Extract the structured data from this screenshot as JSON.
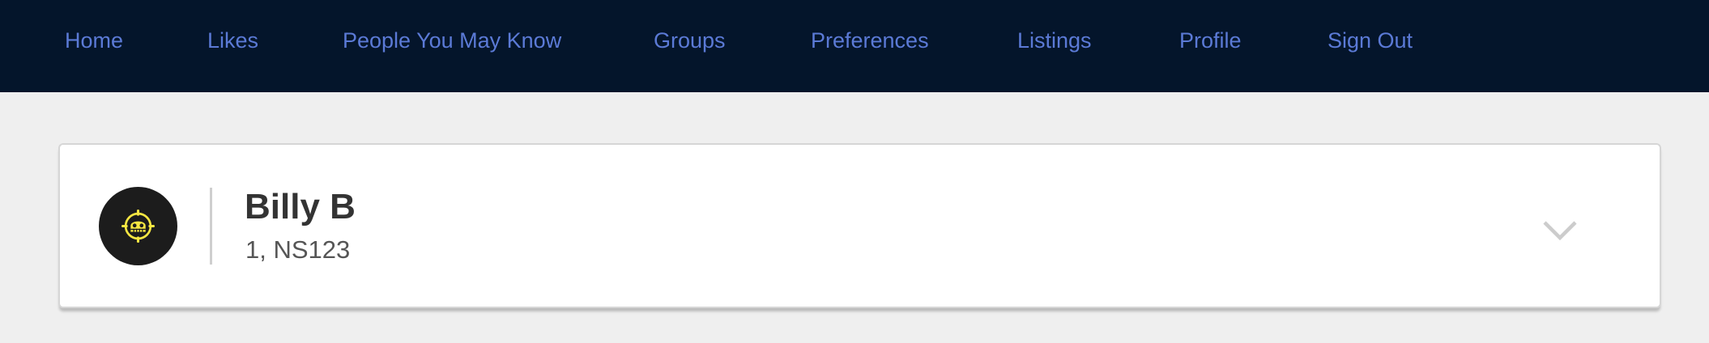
{
  "nav": {
    "items": [
      {
        "label": "Home"
      },
      {
        "label": "Likes"
      },
      {
        "label": "People You May Know"
      },
      {
        "label": "Groups"
      },
      {
        "label": "Preferences"
      },
      {
        "label": "Listings"
      },
      {
        "label": "Profile"
      },
      {
        "label": "Sign Out"
      }
    ]
  },
  "profile_card": {
    "name": "Billy B",
    "subtitle": "1, NS123",
    "avatar_icon": "skull-jolly-roger-icon",
    "expand_icon": "chevron-down-icon"
  },
  "colors": {
    "nav_background": "#04152b",
    "nav_link": "#5b7ad6",
    "page_background": "#efefef",
    "avatar_background": "#1c1c1c",
    "avatar_symbol": "#f5e642"
  }
}
